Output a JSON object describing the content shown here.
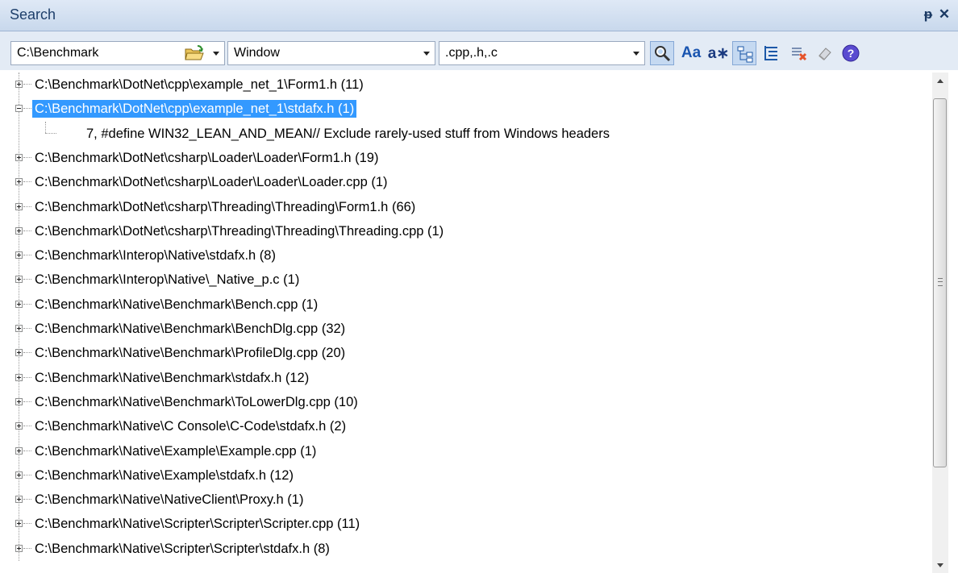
{
  "window": {
    "title": "Search"
  },
  "titlebar_buttons": {
    "pin": "ᵽ",
    "close": "✕"
  },
  "toolbar": {
    "path_value": "C:\\Benchmark",
    "search_value": "Window",
    "filter_value": ".cpp,.h,.c",
    "match_case_glyph": "Aa",
    "regex_glyph": "a∗"
  },
  "tree": {
    "selected_index": 1,
    "items": [
      {
        "label": "C:\\Benchmark\\DotNet\\cpp\\example_net_1\\Form1.h (11)",
        "expanded": false
      },
      {
        "label": "C:\\Benchmark\\DotNet\\cpp\\example_net_1\\stdafx.h (1)",
        "expanded": true,
        "children": [
          "7, #define WIN32_LEAN_AND_MEAN// Exclude rarely-used stuff from Windows headers"
        ]
      },
      {
        "label": "C:\\Benchmark\\DotNet\\csharp\\Loader\\Loader\\Form1.h (19)",
        "expanded": false
      },
      {
        "label": "C:\\Benchmark\\DotNet\\csharp\\Loader\\Loader\\Loader.cpp (1)",
        "expanded": false
      },
      {
        "label": "C:\\Benchmark\\DotNet\\csharp\\Threading\\Threading\\Form1.h (66)",
        "expanded": false
      },
      {
        "label": "C:\\Benchmark\\DotNet\\csharp\\Threading\\Threading\\Threading.cpp (1)",
        "expanded": false
      },
      {
        "label": "C:\\Benchmark\\Interop\\Native\\stdafx.h (8)",
        "expanded": false
      },
      {
        "label": "C:\\Benchmark\\Interop\\Native\\_Native_p.c (1)",
        "expanded": false
      },
      {
        "label": "C:\\Benchmark\\Native\\Benchmark\\Bench.cpp (1)",
        "expanded": false
      },
      {
        "label": "C:\\Benchmark\\Native\\Benchmark\\BenchDlg.cpp (32)",
        "expanded": false
      },
      {
        "label": "C:\\Benchmark\\Native\\Benchmark\\ProfileDlg.cpp (20)",
        "expanded": false
      },
      {
        "label": "C:\\Benchmark\\Native\\Benchmark\\stdafx.h (12)",
        "expanded": false
      },
      {
        "label": "C:\\Benchmark\\Native\\Benchmark\\ToLowerDlg.cpp (10)",
        "expanded": false
      },
      {
        "label": "C:\\Benchmark\\Native\\C Console\\C-Code\\stdafx.h (2)",
        "expanded": false
      },
      {
        "label": "C:\\Benchmark\\Native\\Example\\Example.cpp (1)",
        "expanded": false
      },
      {
        "label": "C:\\Benchmark\\Native\\Example\\stdafx.h (12)",
        "expanded": false
      },
      {
        "label": "C:\\Benchmark\\Native\\NativeClient\\Proxy.h (1)",
        "expanded": false
      },
      {
        "label": "C:\\Benchmark\\Native\\Scripter\\Scripter\\Scripter.cpp (11)",
        "expanded": false
      },
      {
        "label": "C:\\Benchmark\\Native\\Scripter\\Scripter\\stdafx.h (8)",
        "expanded": false
      }
    ]
  },
  "colors": {
    "selection": "#3399ff",
    "titlebar": "#c8d8ec",
    "toolbar": "#e3ebf5"
  },
  "icons": [
    "pin-icon",
    "close-icon",
    "open-folder-icon",
    "dropdown-arrow-icon",
    "find-icon",
    "match-case-icon",
    "regex-icon",
    "tree-view-icon",
    "list-view-icon",
    "clear-results-icon",
    "eraser-icon",
    "help-icon"
  ]
}
